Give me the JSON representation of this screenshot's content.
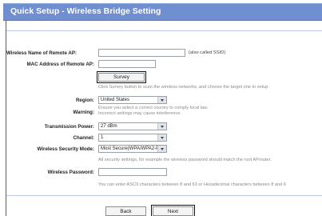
{
  "header": {
    "title": "Quick Setup - Wireless Bridge Setting"
  },
  "form": {
    "remote_ssid": {
      "label": "Wireless Name of Remote AP:",
      "value": "",
      "note": "(also called SSID)"
    },
    "remote_mac": {
      "label": "MAC Address of Remote AP:",
      "value": ""
    },
    "survey": {
      "button": "Survey",
      "hint": "Click Survey button to scan the wireless networks, and choose the target one to setup."
    },
    "region": {
      "label": "Region:",
      "value": "United States"
    },
    "warning": {
      "label": "Warning:",
      "line1": "Ensure you select a correct country to comply local law.",
      "line2": "Incorrect settings may cause interference."
    },
    "tx_power": {
      "label": "Transmission Power:",
      "value": "27 dBm"
    },
    "channel": {
      "label": "Channel:",
      "value": "1"
    },
    "security_mode": {
      "label": "Wireless Security Mode:",
      "value": "Most Secure(WPA/WPA2-PSK",
      "hint": "All security settings, for example the wireless password should match the root AProuter."
    },
    "password": {
      "label": "Wireless Password:",
      "value": "",
      "hint": "You can enter ASCII characters between 8 and 63 or Hexadecimal characters between 8 and 6"
    }
  },
  "footer": {
    "back_label": "Back",
    "next_label": "Next"
  },
  "icons": {
    "dropdown": "chevron-down-icon"
  }
}
